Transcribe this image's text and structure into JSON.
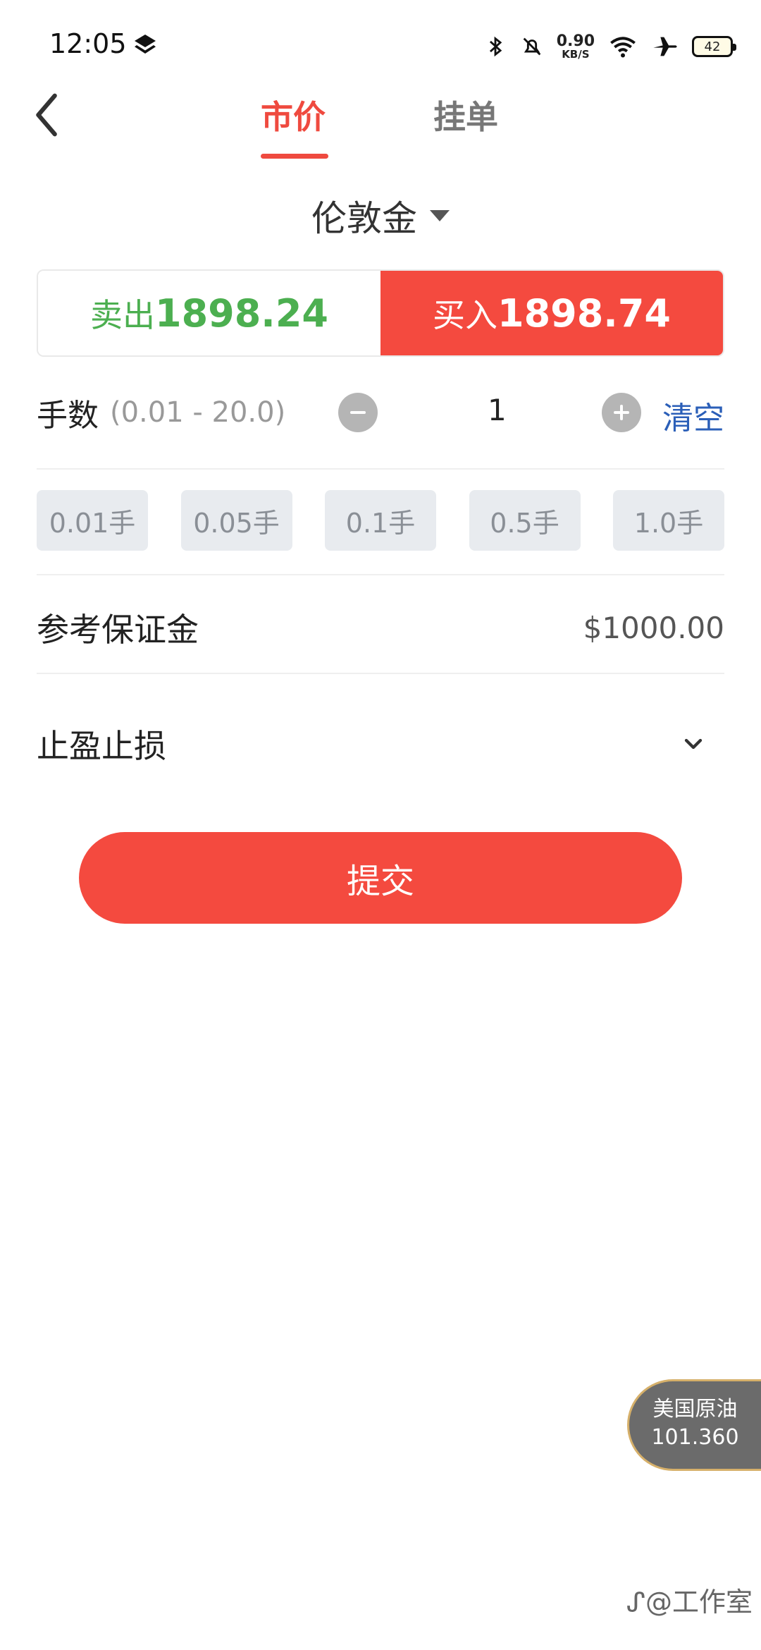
{
  "status": {
    "time": "12:05",
    "speed_value": "0.90",
    "speed_unit": "KB/S",
    "battery": "42"
  },
  "header": {
    "tabs": [
      {
        "label": "市价",
        "active": true
      },
      {
        "label": "挂单",
        "active": false
      }
    ]
  },
  "instrument": {
    "name": "伦敦金"
  },
  "trade": {
    "sell_label": "卖出",
    "sell_price": "1898.24",
    "buy_label": "买入",
    "buy_price": "1898.74"
  },
  "quantity": {
    "label": "手数",
    "range": "(0.01 - 20.0)",
    "value": "1",
    "clear_label": "清空"
  },
  "presets": [
    "0.01手",
    "0.05手",
    "0.1手",
    "0.5手",
    "1.0手"
  ],
  "margin": {
    "label": "参考保证金",
    "value": "$1000.00"
  },
  "tp_sl": {
    "label": "止盈止损"
  },
  "submit": {
    "label": "提交"
  },
  "ticker": {
    "name": "美国原油",
    "price": "101.360"
  },
  "watermark": "@工作室",
  "colors": {
    "accent_red": "#f44a3f",
    "sell_green": "#4caf50",
    "link_blue": "#2b5fb8"
  }
}
